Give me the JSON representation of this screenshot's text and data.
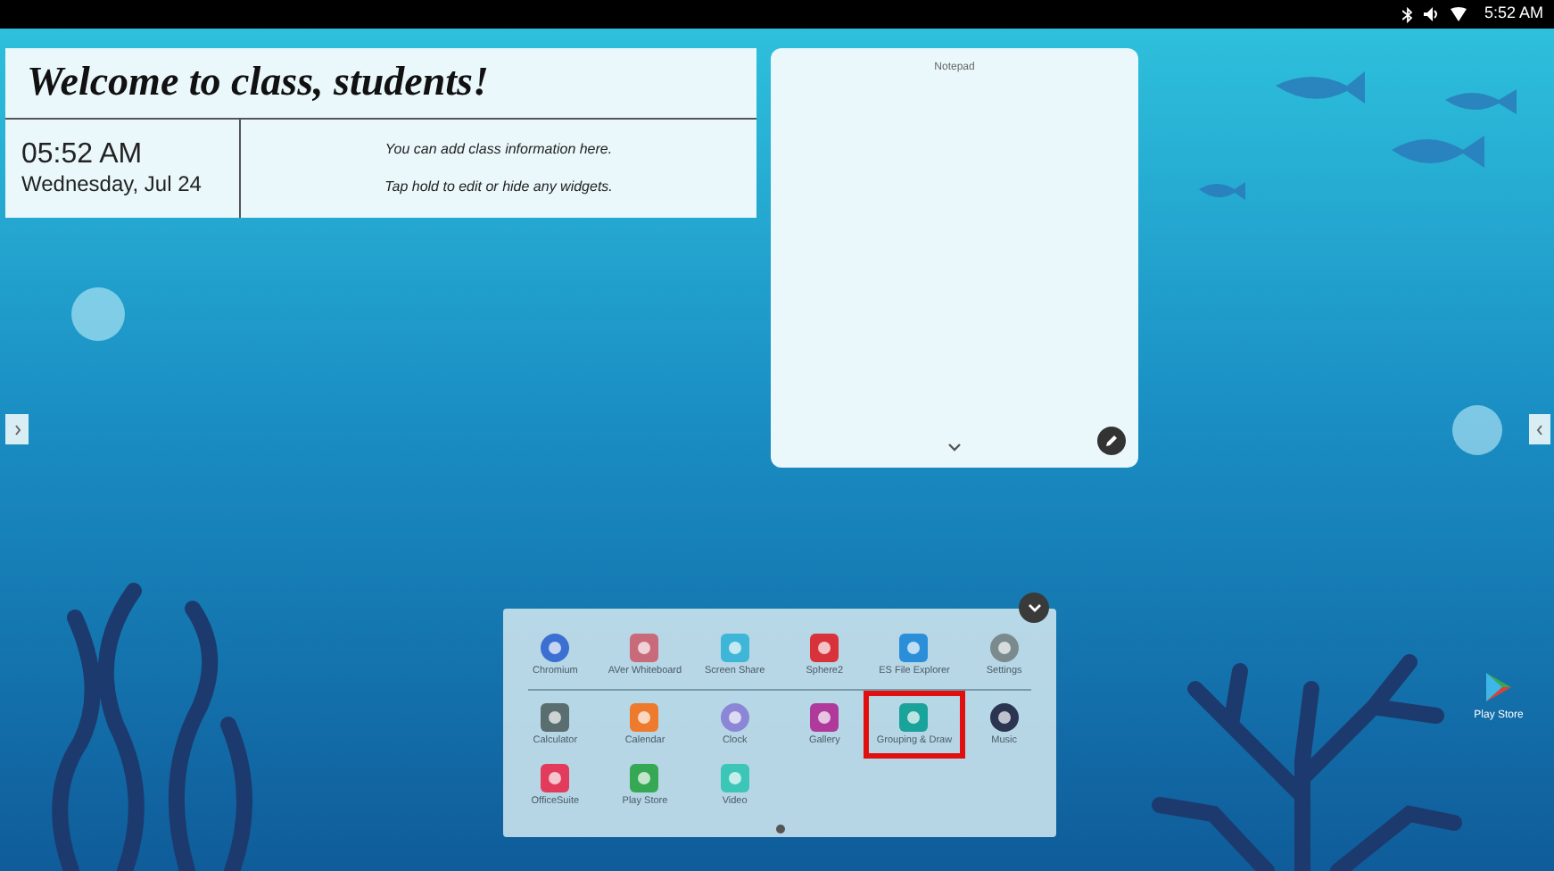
{
  "status_bar": {
    "time": "5:52 AM"
  },
  "welcome_widget": {
    "title": "Welcome to class, students!",
    "time": "05:52 AM",
    "date": "Wednesday, Jul 24",
    "info_lines": [
      "You can add class information here.",
      "Tap hold to edit or hide any widgets."
    ]
  },
  "notepad": {
    "title": "Notepad"
  },
  "app_drawer": {
    "pinned_apps": [
      {
        "label": "Chromium",
        "highlighted": false
      },
      {
        "label": "AVer Whiteboard",
        "highlighted": false
      },
      {
        "label": "Screen Share",
        "highlighted": false
      },
      {
        "label": "Sphere2",
        "highlighted": false
      },
      {
        "label": "ES File Explorer",
        "highlighted": false
      },
      {
        "label": "Settings",
        "highlighted": false
      }
    ],
    "apps": [
      {
        "label": "Calculator",
        "highlighted": false
      },
      {
        "label": "Calendar",
        "highlighted": false
      },
      {
        "label": "Clock",
        "highlighted": false
      },
      {
        "label": "Gallery",
        "highlighted": false
      },
      {
        "label": "Grouping & Draw",
        "highlighted": true
      },
      {
        "label": "Music",
        "highlighted": false
      },
      {
        "label": "OfficeSuite",
        "highlighted": false
      },
      {
        "label": "Play Store",
        "highlighted": false
      },
      {
        "label": "Video",
        "highlighted": false
      }
    ]
  },
  "desktop_shortcut": {
    "label": "Play Store"
  }
}
